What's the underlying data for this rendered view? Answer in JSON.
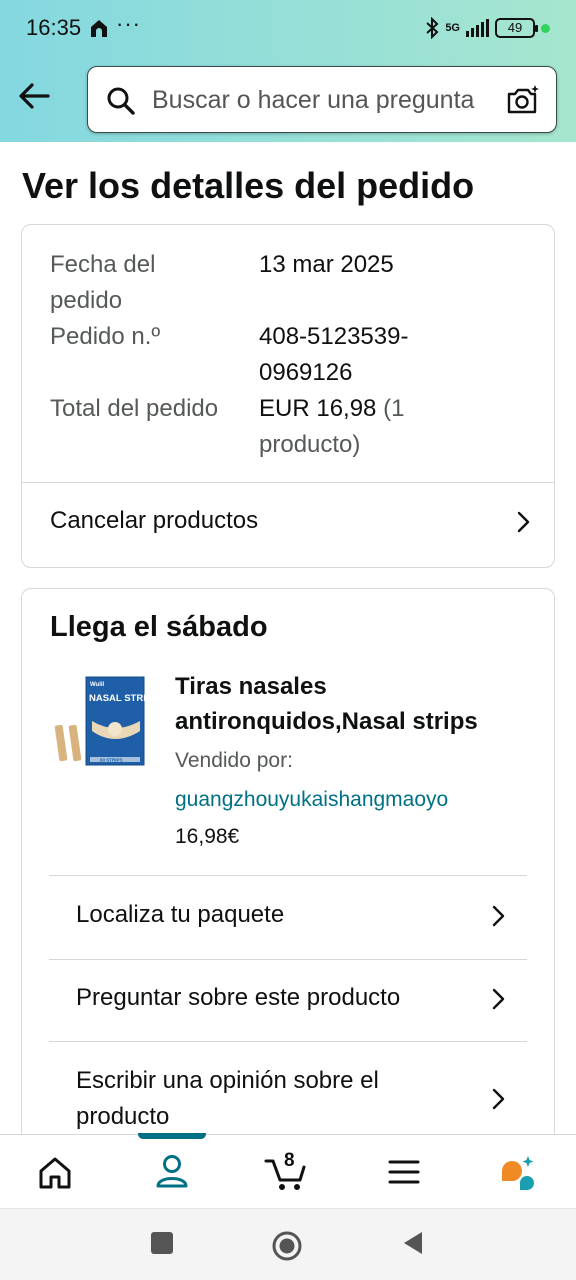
{
  "status_bar": {
    "time": "16:35",
    "dots": "···",
    "network": "5G",
    "battery": "49"
  },
  "header": {
    "search_placeholder": "Buscar o hacer una pregunta",
    "accent_color": "#84d8e0"
  },
  "page": {
    "title": "Ver los detalles del pedido"
  },
  "order_summary": {
    "date_label": "Fecha del pedido",
    "date_value": "13 mar 2025",
    "number_label": "Pedido n.º",
    "number_value_line1": "408-5123539-",
    "number_value_line2": "0969126",
    "total_label": "Total del pedido",
    "total_value": "EUR 16,98",
    "total_count_open": " (1",
    "total_count_close": "producto)",
    "cancel_link": "Cancelar productos"
  },
  "shipment": {
    "arrival": "Llega el sábado",
    "product": {
      "title_line1": "Tiras nasales",
      "title_line2": "antironquidos,Nasal strips",
      "sold_by_label": "Vendido por:",
      "seller": "guangzhouyukaishangmaoyo",
      "price": "16,98€",
      "image_brand": "Wulil",
      "image_name": "NASAL STRIPS",
      "image_count": "60 STRIPS"
    },
    "actions": [
      {
        "label": "Localiza tu paquete"
      },
      {
        "label": "Preguntar sobre este producto"
      },
      {
        "label_line1": "Escribir una opinión sobre el",
        "label_line2": "producto"
      }
    ]
  },
  "bottom_nav": {
    "items": [
      "home-icon",
      "account-icon",
      "cart-icon",
      "menu-icon",
      "rufus-icon"
    ],
    "active": "account-icon",
    "cart_count": "8",
    "active_color": "#007185"
  }
}
